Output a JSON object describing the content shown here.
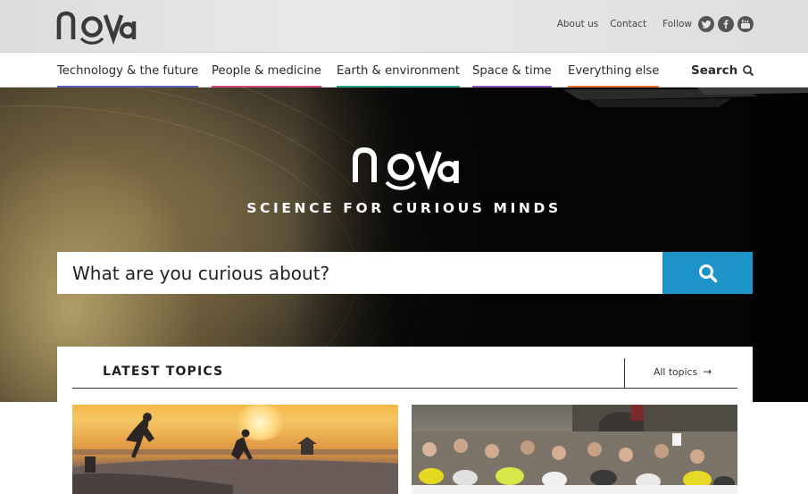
{
  "header": {
    "logo_text": "nova",
    "links": [
      {
        "label": "About us"
      },
      {
        "label": "Contact"
      }
    ],
    "follow_label": "Follow",
    "social_icons": [
      "twitter-icon",
      "facebook-icon",
      "youtube-icon"
    ]
  },
  "nav": {
    "items": [
      {
        "label": "Technology & the future",
        "color": "#5b5fb8"
      },
      {
        "label": "People & medicine",
        "color": "#d14a7c"
      },
      {
        "label": "Earth & environment",
        "color": "#2aa38a"
      },
      {
        "label": "Space & time",
        "color": "#8a57b8"
      },
      {
        "label": "Everything else",
        "color": "#e8702a"
      }
    ],
    "search_label": "Search"
  },
  "hero": {
    "logo_text": "nova",
    "tagline": "SCIENCE FOR CURIOUS MINDS",
    "search_placeholder": "What are you curious about?",
    "search_button_color": "#1d94c9"
  },
  "topics": {
    "title": "LATEST TOPICS",
    "all_link": "All topics"
  }
}
